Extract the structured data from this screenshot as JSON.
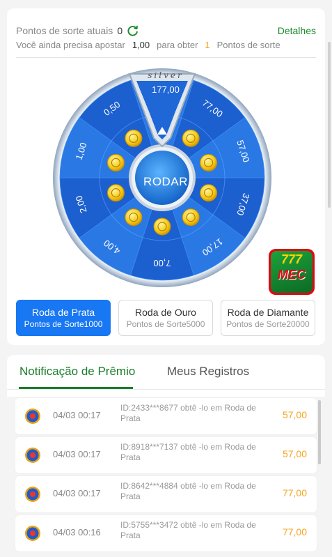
{
  "points": {
    "label": "Pontos de sorte atuais",
    "value": "0",
    "details_label": "Detalhes"
  },
  "need": {
    "prefix": "Você ainda precisa apostar",
    "amount": "1,00",
    "middle": "para obter",
    "count": "1",
    "suffix": "Pontos de sorte"
  },
  "wheel": {
    "tier_label": "silver",
    "spin_label": "RODAR",
    "segments": [
      "177,00",
      "77,00",
      "57,00",
      "37,00",
      "17,00",
      "7,00",
      "4,00",
      "2,00",
      "1,00",
      "0,50"
    ]
  },
  "wheel_tabs": [
    {
      "title": "Roda de Prata",
      "subtitle": "Pontos de Sorte1000"
    },
    {
      "title": "Roda de Ouro",
      "subtitle": "Pontos de Sorte5000"
    },
    {
      "title": "Roda de Diamante",
      "subtitle": "Pontos de Sorte20000"
    }
  ],
  "logo": {
    "digits": "777",
    "text": "MEC"
  },
  "tabs": {
    "notifications": "Notificação de Prêmio",
    "records": "Meus Registros"
  },
  "notifications": [
    {
      "date": "04/03 00:17",
      "text": "ID:2433***8677 obtê -lo em Roda de Prata",
      "amount": "57,00"
    },
    {
      "date": "04/03 00:17",
      "text": "ID:8918***7137 obtê -lo em Roda de Prata",
      "amount": "57,00"
    },
    {
      "date": "04/03 00:17",
      "text": "ID:8642***4884 obtê -lo em Roda de Prata",
      "amount": "77,00"
    },
    {
      "date": "04/03 00:16",
      "text": "ID:5755***3472 obtê -lo em Roda de Prata",
      "amount": "77,00"
    }
  ],
  "colors": {
    "accent_green": "#1a8b2c",
    "active_blue": "#1877f2",
    "amount_orange": "#f5a623"
  }
}
